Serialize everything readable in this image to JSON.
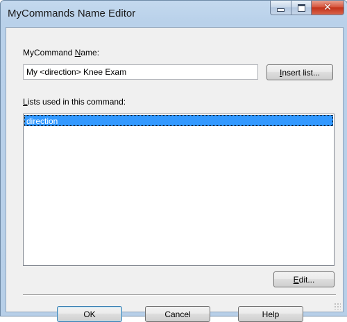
{
  "window": {
    "title": "MyCommands Name Editor",
    "controls": [
      "minimize-icon",
      "maximize-icon",
      "close-icon"
    ]
  },
  "name_field": {
    "label_pre": "MyCommand ",
    "label_mnemonic": "N",
    "label_post": "ame:",
    "value": "My <direction> Knee Exam"
  },
  "insert_button": {
    "mnemonic": "I",
    "rest": "nsert list..."
  },
  "lists_label": {
    "mnemonic": "L",
    "rest": "ists used in this command:"
  },
  "lists": {
    "items": [
      "direction"
    ],
    "selected_index": 0
  },
  "edit_button": {
    "mnemonic": "E",
    "rest": "dit..."
  },
  "footer": {
    "ok_label": "OK",
    "cancel_label": "Cancel",
    "help_label": "Help"
  },
  "colors": {
    "selection": "#3399ff",
    "dialog_bg": "#f0f0f0",
    "frame": "#b9d1ea",
    "close_button": "#c3321a"
  }
}
